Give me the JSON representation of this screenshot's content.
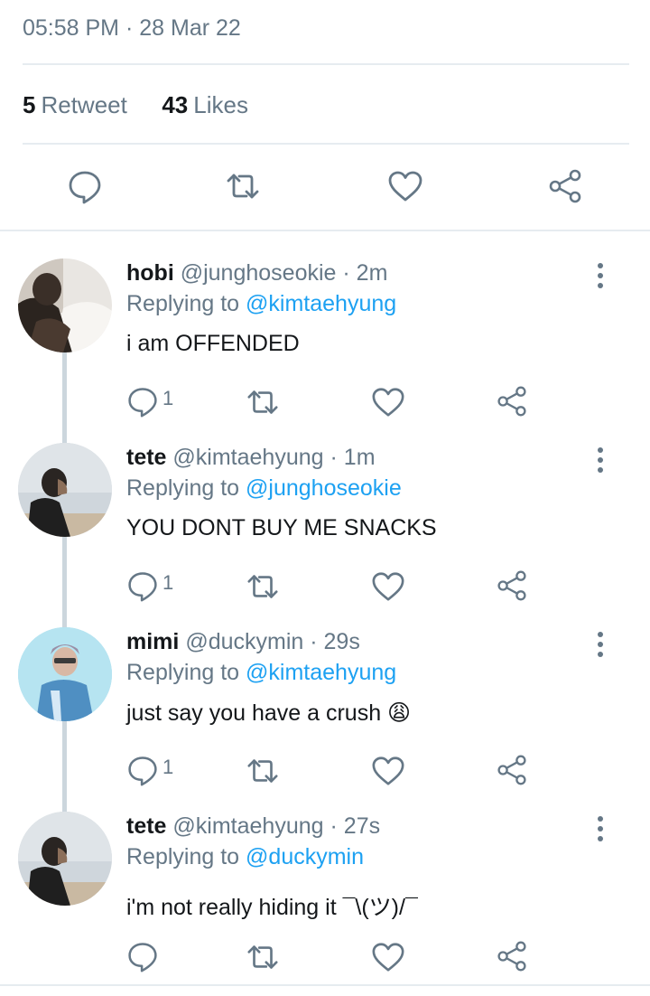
{
  "tweet": {
    "time": "05:58 PM",
    "separator": "·",
    "date": "28 Mar 22",
    "retweet_count": "5",
    "retweet_label": "Retweet",
    "likes_count": "43",
    "likes_label": "Likes"
  },
  "icons": {
    "reply": "reply-bubble-icon",
    "retweet": "retweet-icon",
    "like": "heart-icon",
    "share": "share-icon",
    "more": "more-vertical-icon"
  },
  "colors": {
    "icon_gray": "#657786",
    "link_blue": "#1da1f2",
    "thread_line": "#ccd6dd"
  },
  "replies": [
    {
      "name": "hobi",
      "handle": "@junghoseokie",
      "sep": "·",
      "time": "2m",
      "replying_prefix": "Replying to",
      "replying_to": "@kimtaehyung",
      "text": "i am OFFENDED",
      "reply_count": "1"
    },
    {
      "name": "tete",
      "handle": "@kimtaehyung",
      "sep": "·",
      "time": "1m",
      "replying_prefix": "Replying to",
      "replying_to": "@junghoseokie",
      "text": "YOU DONT BUY ME SNACKS",
      "reply_count": "1"
    },
    {
      "name": "mimi",
      "handle": "@duckymin",
      "sep": "·",
      "time": "29s",
      "replying_prefix": "Replying to",
      "replying_to": "@kimtaehyung",
      "text": "just say you have a crush 😩",
      "reply_count": "1"
    },
    {
      "name": "tete",
      "handle": "@kimtaehyung",
      "sep": "·",
      "time": "27s",
      "replying_prefix": "Replying to",
      "replying_to": "@duckymin",
      "text": "i'm not really hiding it ¯\\(ツ)/¯",
      "reply_count": ""
    }
  ]
}
